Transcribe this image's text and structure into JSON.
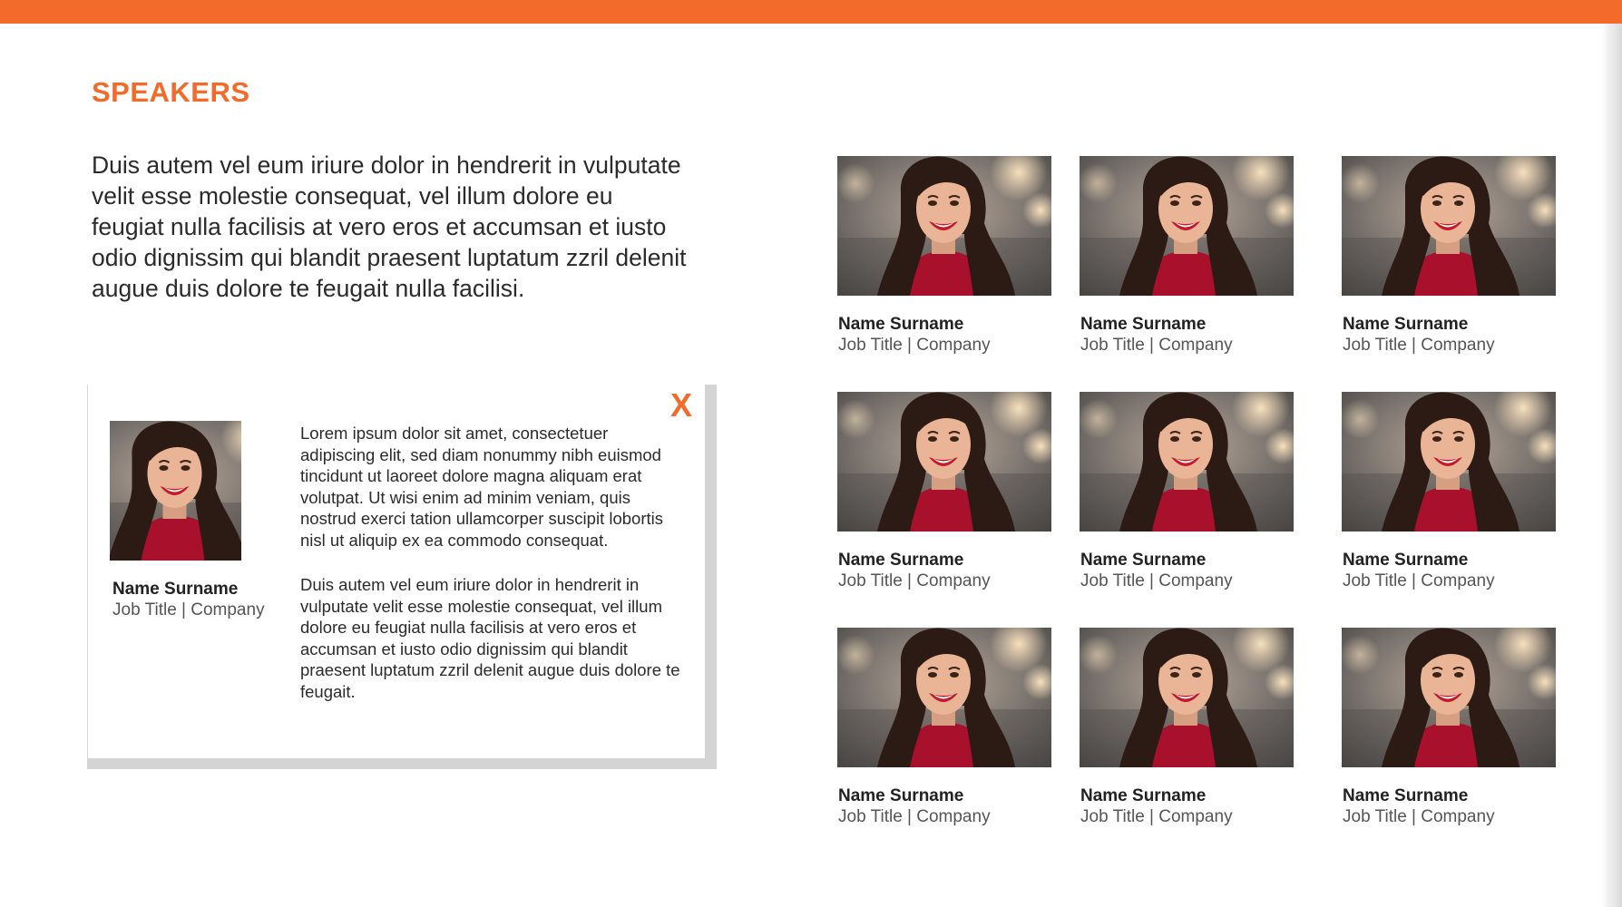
{
  "header": {
    "title": "SPEAKERS"
  },
  "intro": "Duis autem vel eum iriure dolor in hendrerit in vulputate velit esse molestie consequat, vel illum dolore eu feugiat nulla facilisis at vero eros et accumsan et iusto odio dignissim qui blandit praesent luptatum zzril delenit augue duis dolore te feugait nulla facilisi.",
  "popup": {
    "close_label": "X",
    "name": "Name Surname",
    "job": "Job Title | Company",
    "bio": [
      "Lorem ipsum dolor sit amet, consectetuer adipiscing elit, sed diam nonummy nibh euismod tincidunt ut laoreet dolore magna aliquam erat volutpat. Ut wisi enim ad minim veniam, quis nostrud exerci tation ullamcorper suscipit lobortis nisl ut aliquip ex ea commodo consequat.",
      "Duis autem vel eum iriure dolor in hendrerit in vulputate velit esse molestie consequat, vel illum dolore eu feugiat nulla facilisis at vero eros et accumsan et iusto odio dignissim qui blandit praesent luptatum zzril delenit augue duis dolore te feugait."
    ]
  },
  "speakers": [
    {
      "name": "Name Surname",
      "job": "Job Title | Company"
    },
    {
      "name": "Name Surname",
      "job": "Job Title | Company"
    },
    {
      "name": "Name Surname",
      "job": "Job Title | Company"
    },
    {
      "name": "Name Surname",
      "job": "Job Title | Company"
    },
    {
      "name": "Name Surname",
      "job": "Job Title | Company"
    },
    {
      "name": "Name Surname",
      "job": "Job Title | Company"
    },
    {
      "name": "Name Surname",
      "job": "Job Title | Company"
    },
    {
      "name": "Name Surname",
      "job": "Job Title | Company"
    },
    {
      "name": "Name Surname",
      "job": "Job Title | Company"
    }
  ],
  "colors": {
    "accent": "#f26b2a",
    "shirt": "#a8102b",
    "hair": "#2b1b14",
    "skin": "#e9b596"
  }
}
